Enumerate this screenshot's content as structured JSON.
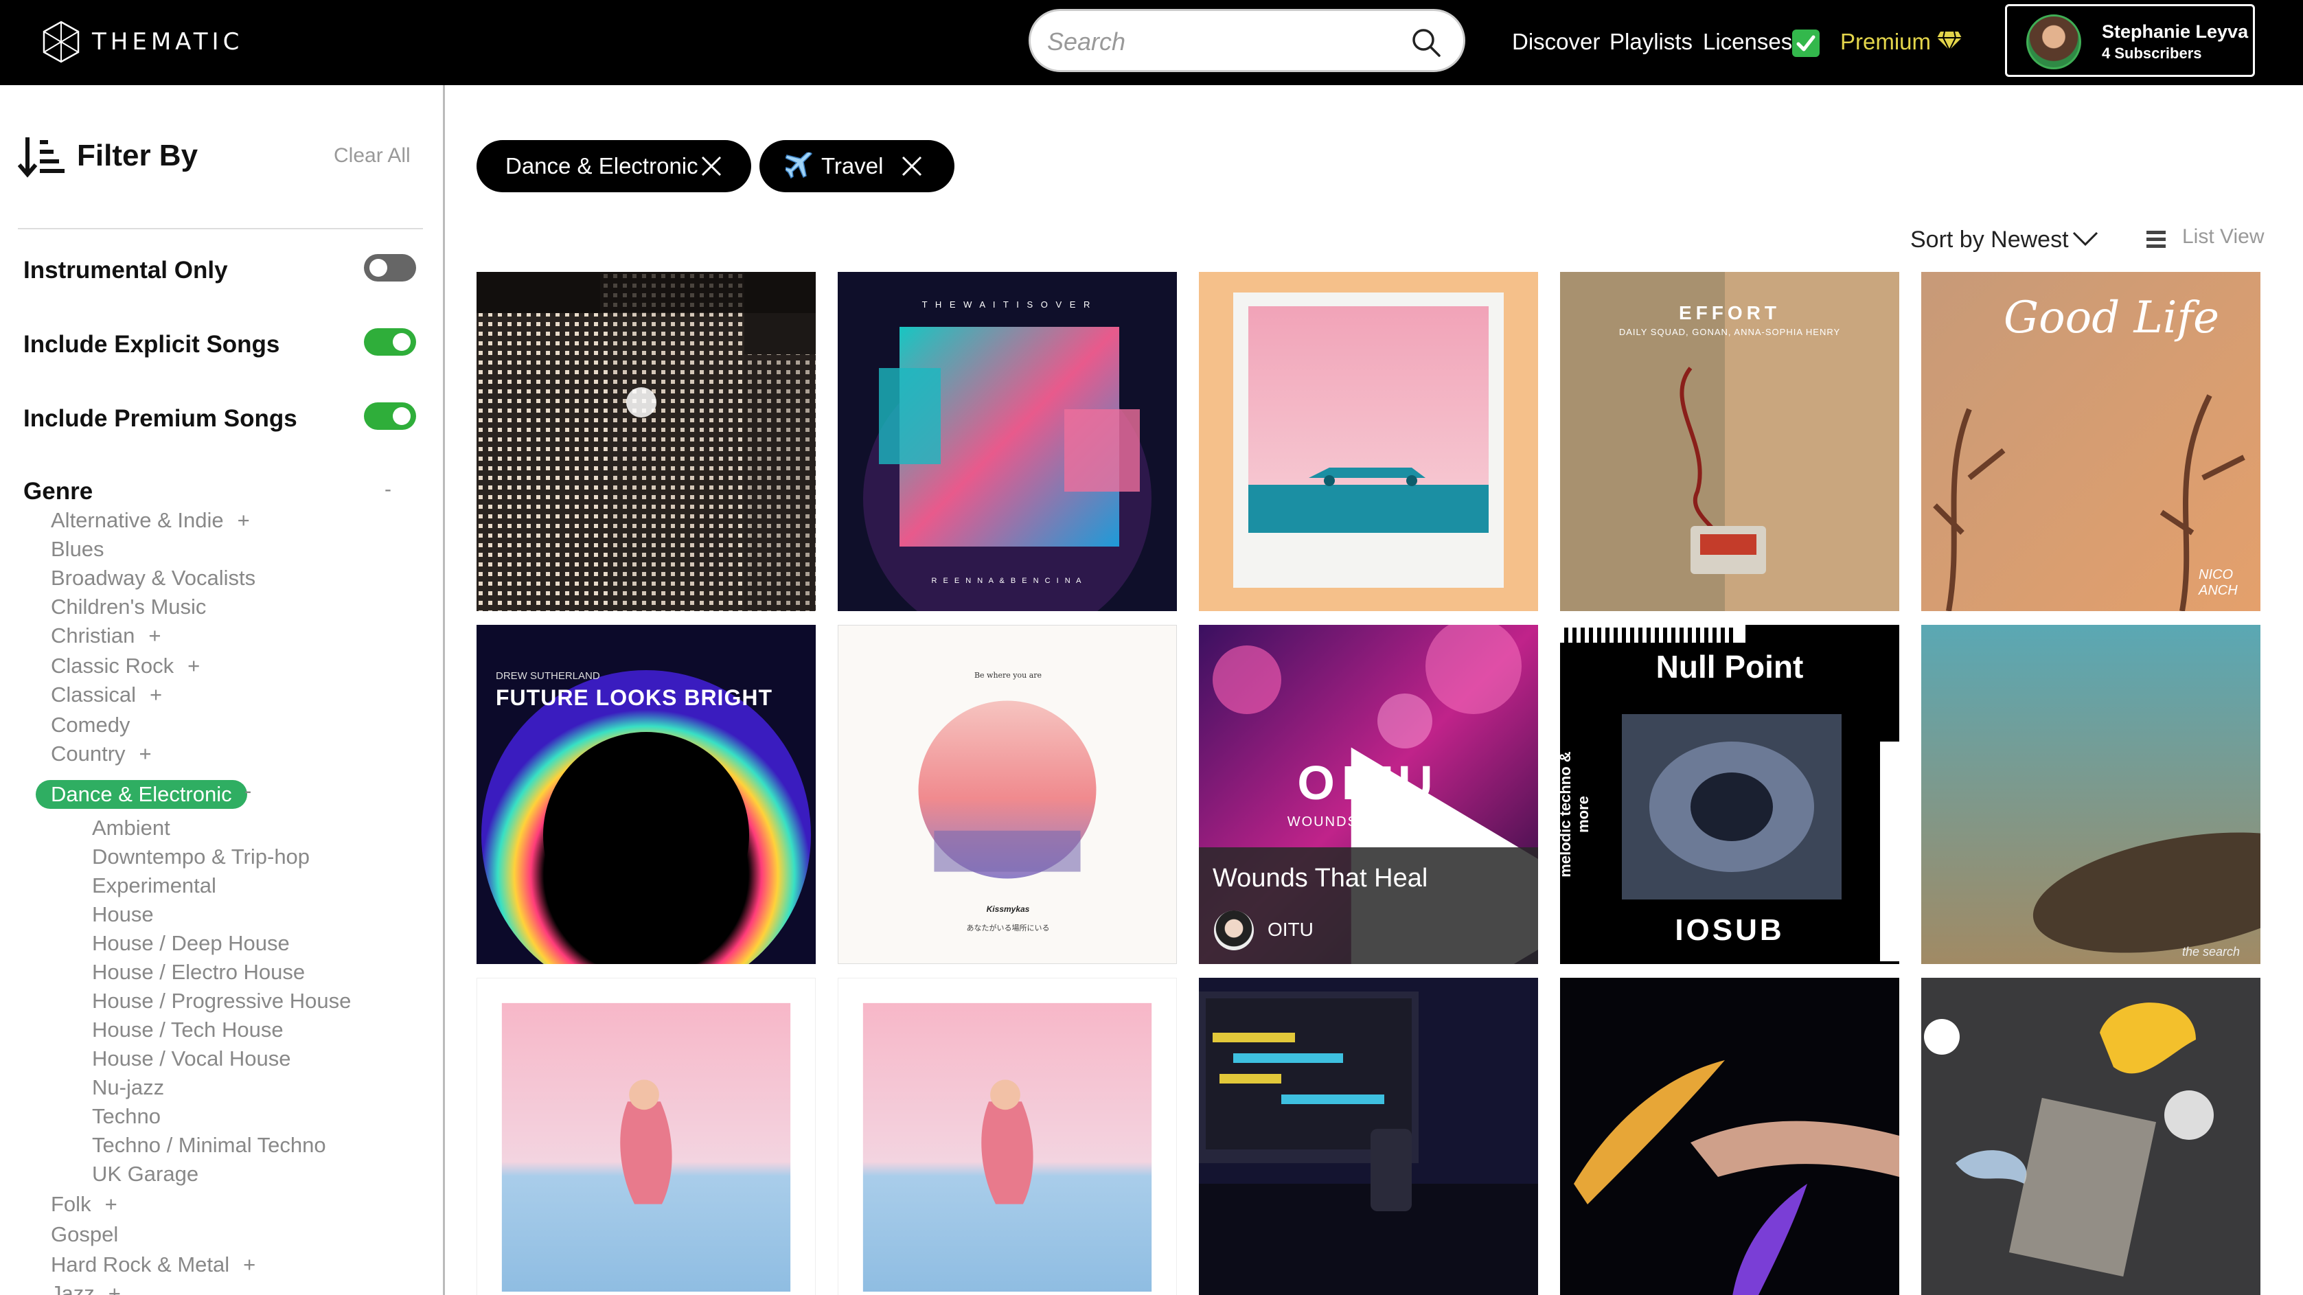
{
  "header": {
    "logo_text": "THEMATIC",
    "search_placeholder": "Search",
    "nav": {
      "discover": "Discover",
      "playlists": "Playlists",
      "licenses": "Licenses",
      "premium": "Premium"
    },
    "user": {
      "name": "Stephanie Leyva",
      "subscribers": "4 Subscribers"
    }
  },
  "sidebar": {
    "title": "Filter By",
    "clear_all": "Clear All",
    "toggles": [
      {
        "label": "Instrumental Only",
        "on": false
      },
      {
        "label": "Include Explicit Songs",
        "on": true
      },
      {
        "label": "Include Premium Songs",
        "on": true
      }
    ],
    "genre_title": "Genre",
    "genre_collapse": "-",
    "genres_top": [
      {
        "label": "Alternative & Indie",
        "expandable": "+"
      },
      {
        "label": "Blues",
        "expandable": ""
      },
      {
        "label": "Broadway & Vocalists",
        "expandable": ""
      },
      {
        "label": "Children's Music",
        "expandable": ""
      },
      {
        "label": "Christian",
        "expandable": "+"
      },
      {
        "label": "Classic Rock",
        "expandable": "+"
      },
      {
        "label": "Classical",
        "expandable": "+"
      },
      {
        "label": "Comedy",
        "expandable": ""
      },
      {
        "label": "Country",
        "expandable": "+"
      }
    ],
    "selected_genre": "Dance & Electronic",
    "selected_collapse": "-",
    "subgenres": [
      "Ambient",
      "Downtempo & Trip-hop",
      "Experimental",
      "House",
      "House / Deep House",
      "House / Electro House",
      "House / Progressive House",
      "House / Tech House",
      "House / Vocal House",
      "Nu-jazz",
      "Techno",
      "Techno / Minimal Techno",
      "UK Garage"
    ],
    "genres_bottom": [
      {
        "label": "Folk",
        "expandable": "+"
      },
      {
        "label": "Gospel",
        "expandable": ""
      },
      {
        "label": "Hard Rock & Metal",
        "expandable": "+"
      },
      {
        "label": "Jazz",
        "expandable": "+"
      }
    ]
  },
  "filters": {
    "chips": [
      {
        "label": "Dance & Electronic",
        "icon": ""
      },
      {
        "label": "Travel",
        "icon": "airplane-icon"
      }
    ]
  },
  "toolbar": {
    "sort_label": "Sort by Newest",
    "list_view": "List View"
  },
  "grid": {
    "tiles": [
      {
        "name": "night-city-cover",
        "text": ""
      },
      {
        "name": "the-wait-is-over-cover",
        "text": "T H E   W A I T   I S   O V E R",
        "subtext": "R E E N N A   &   B E N   C I N A"
      },
      {
        "name": "convertible-sunset-cover",
        "text": ""
      },
      {
        "name": "effort-cover",
        "text": "EFFORT",
        "subtext": "DAILY SQUAD, GONAN, ANNA-SOPHIA HENRY"
      },
      {
        "name": "good-life-cover",
        "text": "Good Life",
        "subtext": "NICO ANCH"
      },
      {
        "name": "future-looks-bright-cover",
        "text": "FUTURE LOOKS BRIGHT",
        "subtext": "DREW SUTHERLAND"
      },
      {
        "name": "be-where-you-are-cover",
        "text": "Be where you are",
        "subtext": "Kissmykas",
        "subtext2": "あなたがいる場所にいる"
      },
      {
        "name": "wounds-that-heal-cover",
        "text": "Wounds That Heal",
        "artist": "OITU",
        "art_text": "OITU",
        "art_sub": "WOUNDS THAT HEAL"
      },
      {
        "name": "null-point-cover",
        "text": "Null Point",
        "subtext": "IOSUB",
        "side": "melodic techno & more"
      },
      {
        "name": "skateboard-cover",
        "text": "the search"
      },
      {
        "name": "pink-sea-girl-cover-1",
        "text": ""
      },
      {
        "name": "pink-sea-girl-cover-2",
        "text": ""
      },
      {
        "name": "studio-desk-cover",
        "text": ""
      },
      {
        "name": "feather-hand-cover",
        "text": ""
      },
      {
        "name": "collage-objects-cover",
        "text": ""
      }
    ]
  },
  "colors": {
    "accent_green": "#2fae62",
    "premium_gold": "#e3d54b",
    "toggle_on": "#2fae3a",
    "topbar": "#000000"
  }
}
